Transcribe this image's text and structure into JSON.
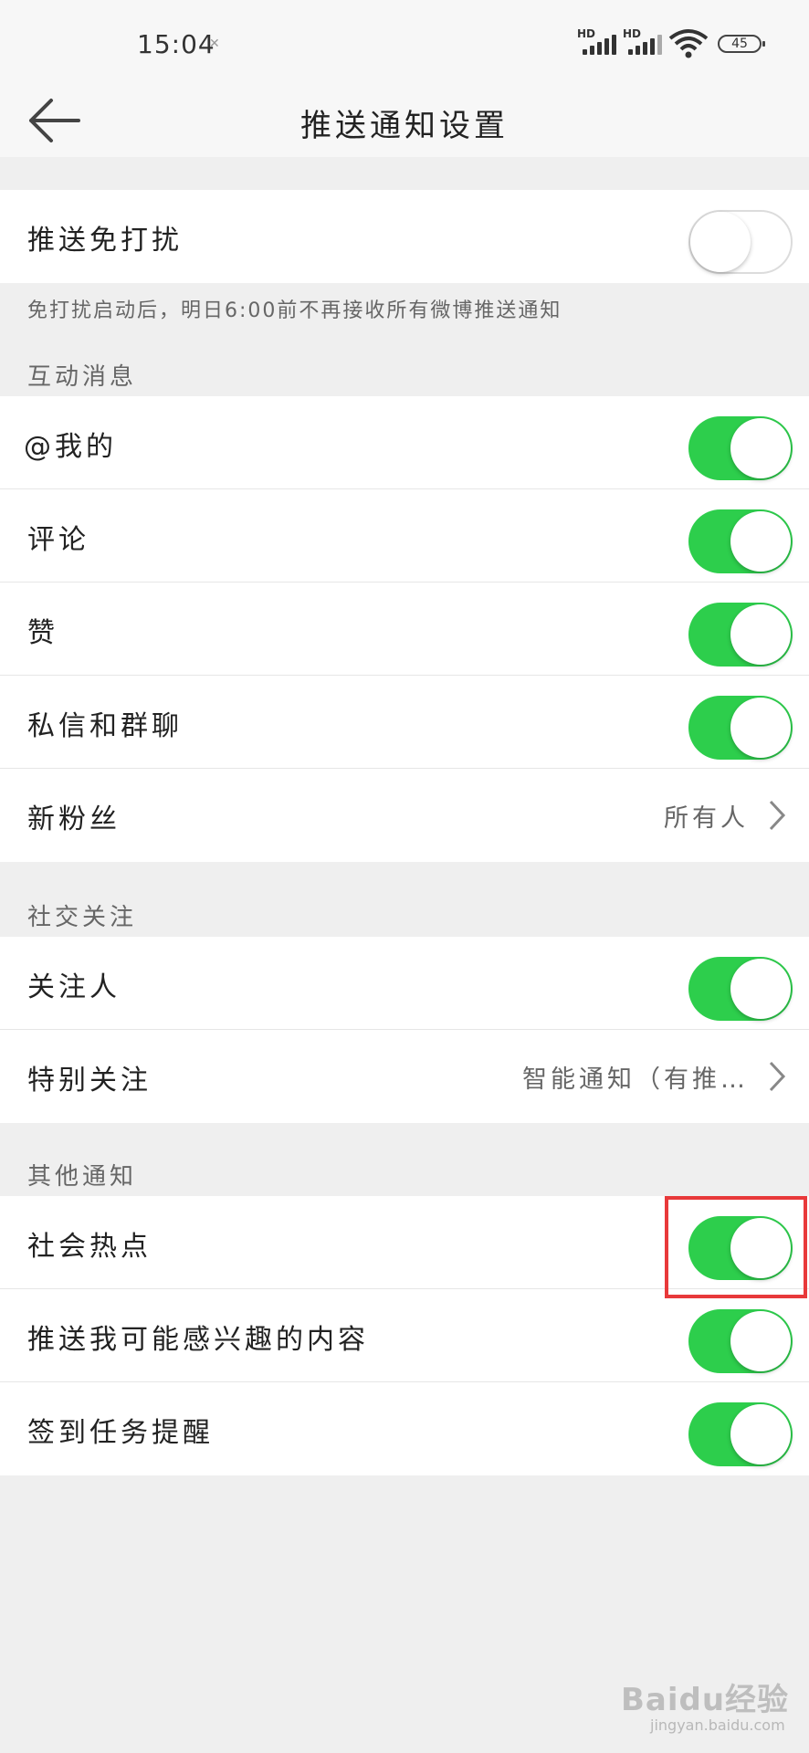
{
  "status_bar": {
    "time": "15:04",
    "signal1_label": "HD",
    "signal2_label": "HD",
    "battery": "45"
  },
  "navbar": {
    "title": "推送通知设置",
    "back_icon": "arrow-left-icon"
  },
  "dnd": {
    "label": "推送免打扰",
    "enabled": false,
    "note": "免打扰启动后，明日6:00前不再接收所有微博推送通知"
  },
  "sections": {
    "interaction": {
      "header": "互动消息",
      "items": [
        {
          "label": "@我的",
          "on": true
        },
        {
          "label": "评论",
          "on": true
        },
        {
          "label": "赞",
          "on": true
        },
        {
          "label": "私信和群聊",
          "on": true
        },
        {
          "label": "新粉丝",
          "value": "所有人"
        }
      ]
    },
    "social": {
      "header": "社交关注",
      "items": [
        {
          "label": "关注人",
          "on": true
        },
        {
          "label": "特别关注",
          "value": "智能通知（有推…"
        }
      ]
    },
    "other": {
      "header": "其他通知",
      "items": [
        {
          "label": "社会热点",
          "on": true
        },
        {
          "label": "推送我可能感兴趣的内容",
          "on": true
        },
        {
          "label": "签到任务提醒",
          "on": true
        }
      ]
    }
  },
  "colors": {
    "toggle_on": "#2dce4c",
    "highlight": "#e8393a",
    "background": "#efefef"
  },
  "watermark": {
    "text": "Baidu经验",
    "sub": "jingyan.baidu.com"
  }
}
